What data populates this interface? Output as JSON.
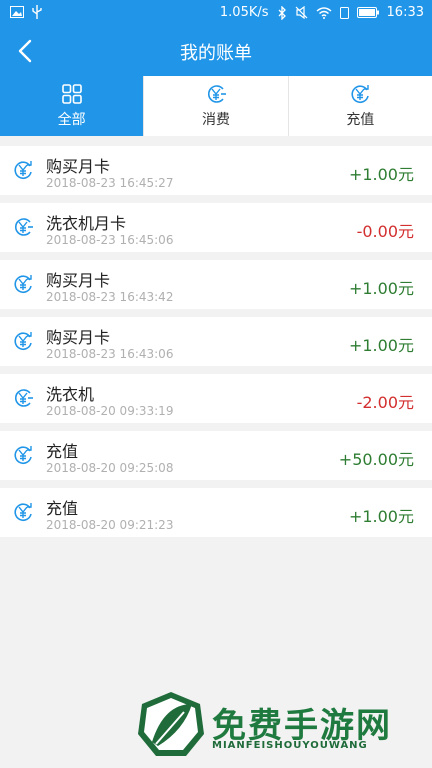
{
  "status_bar": {
    "speed": "1.05K/s",
    "time": "16:33"
  },
  "header": {
    "title": "我的账单"
  },
  "tabs": [
    {
      "label": "全部",
      "icon": "grid-icon",
      "active": true
    },
    {
      "label": "消费",
      "icon": "yen-minus-icon",
      "active": false
    },
    {
      "label": "充值",
      "icon": "yen-refresh-icon",
      "active": false
    }
  ],
  "records": [
    {
      "name": "购买月卡",
      "time": "2018-08-23 16:45:27",
      "amount": "+1.00元",
      "type": "recharge"
    },
    {
      "name": "洗衣机月卡",
      "time": "2018-08-23 16:45:06",
      "amount": "-0.00元",
      "type": "consume"
    },
    {
      "name": "购买月卡",
      "time": "2018-08-23 16:43:42",
      "amount": "+1.00元",
      "type": "recharge"
    },
    {
      "name": "购买月卡",
      "time": "2018-08-23 16:43:06",
      "amount": "+1.00元",
      "type": "recharge"
    },
    {
      "name": "洗衣机",
      "time": "2018-08-20 09:33:19",
      "amount": "-2.00元",
      "type": "consume"
    },
    {
      "name": "充值",
      "time": "2018-08-20 09:25:08",
      "amount": "+50.00元",
      "type": "recharge"
    },
    {
      "name": "充值",
      "time": "2018-08-20 09:21:23",
      "amount": "+1.00元",
      "type": "recharge"
    }
  ],
  "watermark": {
    "title": "免费手游网",
    "subtitle": "MIANFEISHOUYOUWANG"
  },
  "colors": {
    "primary": "#2196e8",
    "positive": "#2e7d32",
    "negative": "#d32f2f"
  }
}
